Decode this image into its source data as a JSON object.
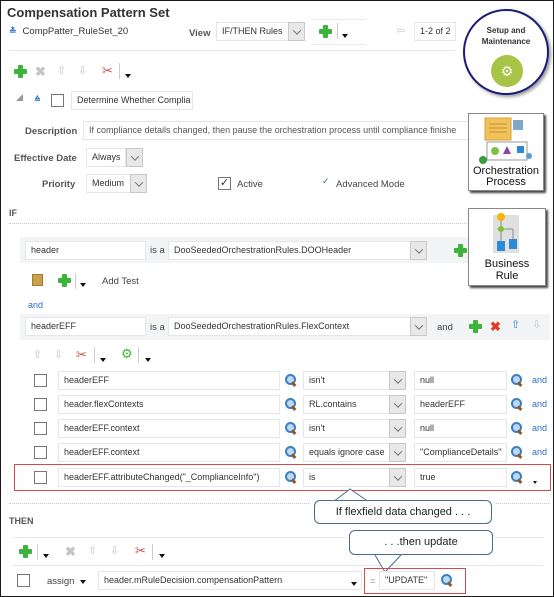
{
  "page": {
    "title": "Compensation Pattern Set",
    "ruleset_name": "CompPatter_RuleSet_20",
    "view_label": "View",
    "view_value": "IF/THEN Rules",
    "pagination": "1-2 of 2"
  },
  "badges": {
    "setup": "Setup and Maintenance",
    "orchestration_line1": "Orchestration",
    "orchestration_line2": "Process",
    "business_line1": "Business",
    "business_line2": "Rule"
  },
  "rule": {
    "name": "Determine Whether Complia",
    "description_label": "Description",
    "description": "If compliance details changed, then pause the orchestration process until compliance finishe",
    "effective_date_label": "Effective Date",
    "effective_date": "Always",
    "priority_label": "Priority",
    "priority": "Medium",
    "active_label": "Active",
    "advanced_mode_label": "Advanced Mode"
  },
  "if_section": {
    "heading": "IF",
    "pattern1": {
      "var": "header",
      "is_a": "is a",
      "type": "DooSeededOrchestrationRules.DOOHeader"
    },
    "add_test_label": "Add Test",
    "and_label": "and",
    "pattern2": {
      "var": "headerEFF",
      "is_a": "is a",
      "type": "DooSeededOrchestrationRules.FlexContext",
      "and_label": "and"
    },
    "tests": [
      {
        "left": "headerEFF",
        "op": "isn't",
        "right": "null",
        "conj": "and"
      },
      {
        "left": "header.flexContexts",
        "op": "RL.contains",
        "right": "headerEFF",
        "conj": "and"
      },
      {
        "left": "headerEFF.context",
        "op": "isn't",
        "right": "null",
        "conj": "and"
      },
      {
        "left": "headerEFF.context",
        "op": "equals ignore case",
        "right": "\"ComplianceDetails\"",
        "conj": "and"
      },
      {
        "left": "headerEFF.attributeChanged(\"_ComplianceInfo\")",
        "op": "is",
        "right": "true",
        "conj": ""
      }
    ]
  },
  "then_section": {
    "heading": "THEN",
    "action": "assign",
    "target": "header.mRuleDecision.compensationPattern",
    "equals": "=",
    "value": "\"UPDATE\""
  },
  "callouts": {
    "if_changed": "If flexfield  data changed . . .",
    "then_update": ". . .then update"
  }
}
